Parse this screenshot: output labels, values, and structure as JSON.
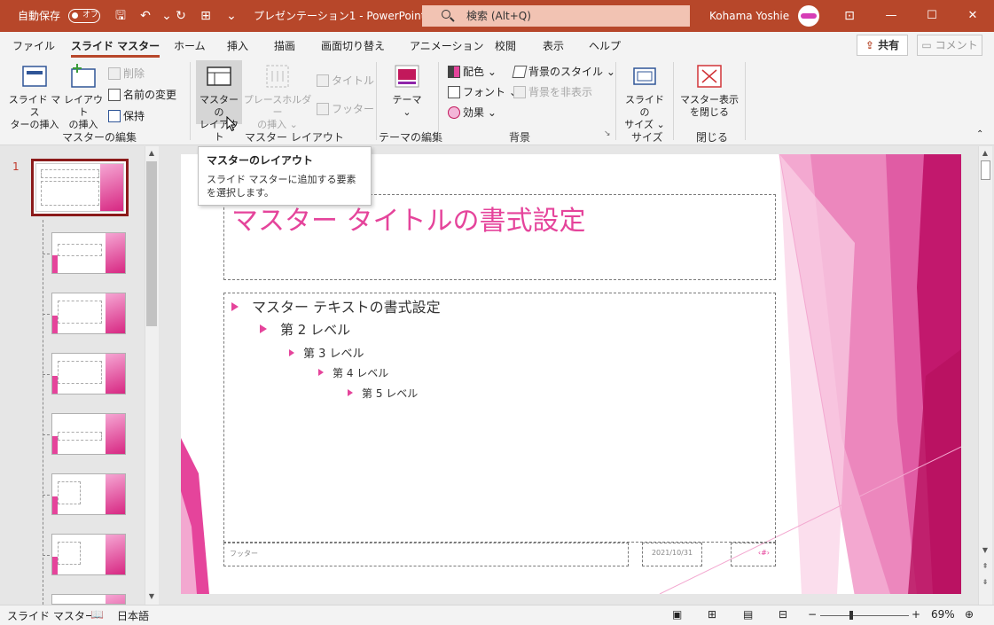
{
  "titlebar": {
    "autosave": "自動保存",
    "autosave_state": "オフ",
    "doc_title": "プレゼンテーション1 - PowerPoint",
    "search": "検索 (Alt+Q)",
    "user": "Kohama Yoshie",
    "minimize": "—",
    "restore": "☐",
    "close": "✕"
  },
  "tabs": [
    "ファイル",
    "スライド マスター",
    "ホーム",
    "挿入",
    "描画",
    "画面切り替え",
    "アニメーション",
    "校閲",
    "表示",
    "ヘルプ"
  ],
  "share": "共有",
  "comment": "コメント",
  "ribbon": {
    "insert_master": [
      "スライド マス",
      "ターの挿入"
    ],
    "insert_layout": [
      "レイアウト",
      "の挿入"
    ],
    "delete": "削除",
    "rename": "名前の変更",
    "preserve": "保持",
    "group_master_edit": "マスターの編集",
    "master_layout": [
      "マスターの",
      "レイアウト"
    ],
    "insert_placeholder": [
      "プレースホルダー",
      "の挿入 ⌄"
    ],
    "title_check": "タイトル",
    "footer_check": "フッター",
    "group_master_layout": "マスター レイアウト",
    "theme": "テーマ",
    "group_theme_edit": "テーマの編集",
    "colors": "配色 ⌄",
    "fonts": "フォント ⌄",
    "effects": "効果 ⌄",
    "bg_styles": "背景のスタイル ⌄",
    "hide_bg": "背景を非表示",
    "group_background": "背景",
    "slide_size": [
      "スライドの",
      "サイズ ⌄"
    ],
    "group_size": "サイズ",
    "close_master": [
      "マスター表示",
      "を閉じる"
    ],
    "group_close": "閉じる"
  },
  "tooltip": {
    "title": "マスターのレイアウト",
    "body": "スライド マスターに追加する要素を選択します。"
  },
  "thumbs": {
    "slide_number": "1"
  },
  "slide": {
    "title": "マスター タイトルの書式設定",
    "level1": "マスター テキストの書式設定",
    "level2": "第 2 レベル",
    "level3": "第 3 レベル",
    "level4": "第 4 レベル",
    "level5": "第 5 レベル",
    "footer": "フッター",
    "date": "2021/10/31",
    "page_num": "‹#›"
  },
  "status": {
    "mode": "スライド マスター",
    "language": "日本語",
    "zoom_level": "69%",
    "zoom_fraction": 0.69
  },
  "colors": {
    "accent": "#b7472a",
    "theme_pink": "#e5449b"
  }
}
